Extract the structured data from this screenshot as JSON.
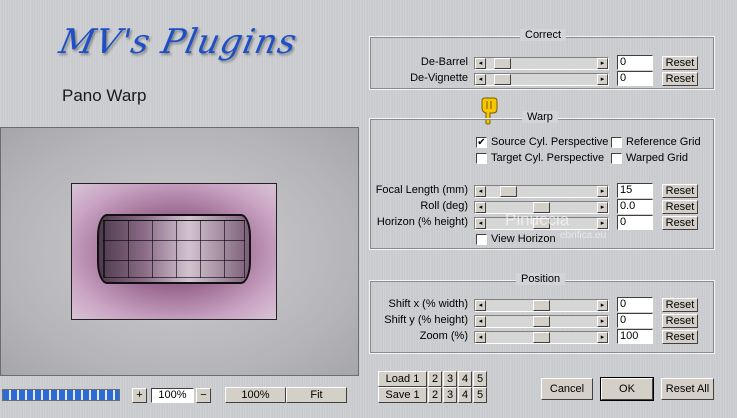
{
  "header": {
    "logo_text": "MV's Plugins",
    "title": "Pano Warp"
  },
  "correct": {
    "title": "Correct",
    "rows": [
      {
        "label": "De-Barrel",
        "value": "0",
        "reset": "Reset",
        "level": 0.08
      },
      {
        "label": "De-Vignette",
        "value": "0",
        "reset": "Reset",
        "level": 0.08
      }
    ]
  },
  "warp": {
    "title": "Warp",
    "checkboxes": [
      {
        "label": "Source Cyl. Perspective",
        "checked": true
      },
      {
        "label": "Reference Grid",
        "checked": false
      },
      {
        "label": "Target Cyl. Perspective",
        "checked": false
      },
      {
        "label": "Warped Grid",
        "checked": false
      }
    ],
    "rows": [
      {
        "label": "Focal Length (mm)",
        "value": "15",
        "reset": "Reset",
        "level": 0.15
      },
      {
        "label": "Roll (deg)",
        "value": "0.0",
        "reset": "Reset",
        "level": 0.5
      },
      {
        "label": "Horizon (% height)",
        "value": "0",
        "reset": "Reset",
        "level": 0.5
      }
    ],
    "view_horizon": {
      "label": "View Horizon",
      "checked": false
    }
  },
  "position": {
    "title": "Position",
    "rows": [
      {
        "label": "Shift x (% width)",
        "value": "0",
        "reset": "Reset",
        "level": 0.5
      },
      {
        "label": "Shift y (% height)",
        "value": "0",
        "reset": "Reset",
        "level": 0.5
      },
      {
        "label": "Zoom (%)",
        "value": "100",
        "reset": "Reset",
        "level": 0.5
      }
    ]
  },
  "zoom_bar": {
    "plus": "+",
    "value": "100%",
    "minus": "−",
    "hundred": "100%",
    "fit": "Fit"
  },
  "presets": {
    "load": "Load 1",
    "save": "Save 1",
    "numbers": [
      "2",
      "3",
      "4",
      "5"
    ]
  },
  "actions": {
    "cancel": "Cancel",
    "ok": "OK",
    "reset_all": "Reset All"
  },
  "watermark": {
    "line1": "Pinuccia",
    "line2": "ebrifica.eu"
  },
  "progress": {
    "fraction": 1.0
  }
}
